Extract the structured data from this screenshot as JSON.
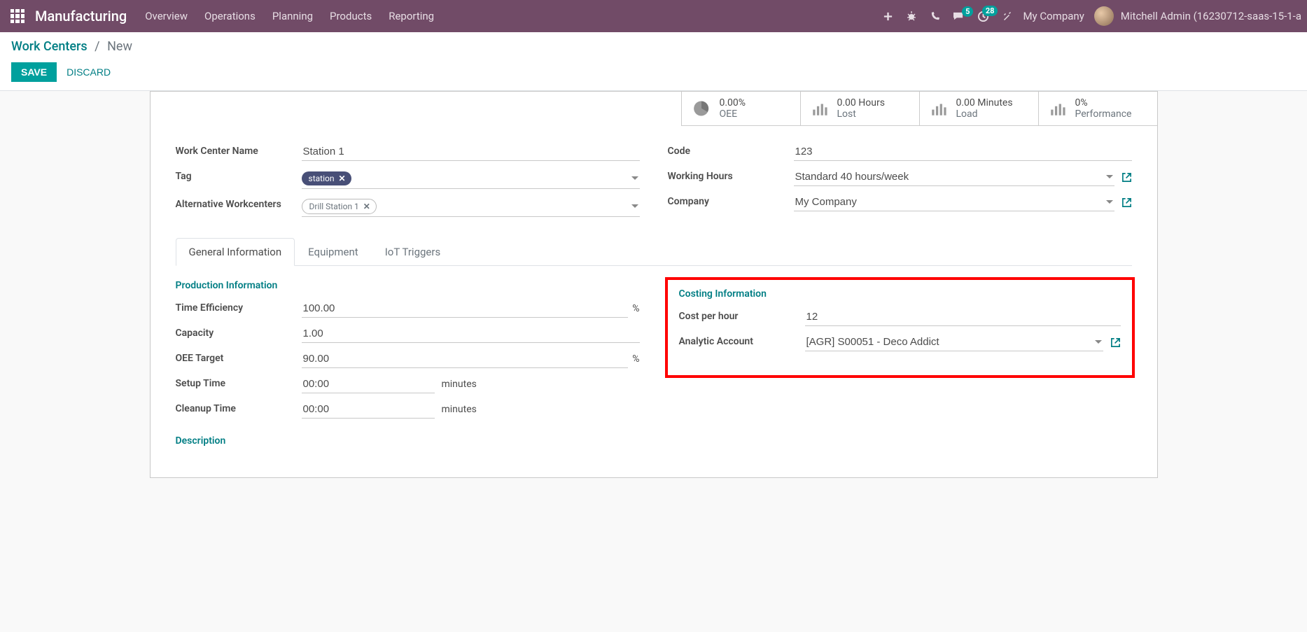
{
  "nav": {
    "brand": "Manufacturing",
    "menu": [
      "Overview",
      "Operations",
      "Planning",
      "Products",
      "Reporting"
    ],
    "msg_badge": "5",
    "activity_badge": "28",
    "company": "My Company",
    "user": "Mitchell Admin (16230712-saas-15-1-a"
  },
  "breadcrumb": {
    "root": "Work Centers",
    "leaf": "New"
  },
  "buttons": {
    "save": "Save",
    "discard": "Discard"
  },
  "stats": {
    "oee": {
      "value": "0.00%",
      "label": "OEE"
    },
    "lost": {
      "value": "0.00 Hours",
      "label": "Lost"
    },
    "load": {
      "value": "0.00 Minutes",
      "label": "Load"
    },
    "perf": {
      "value": "0%",
      "label": "Performance"
    }
  },
  "fields": {
    "name_label": "Work Center Name",
    "name_value": "Station 1",
    "tag_label": "Tag",
    "tag_value": "station",
    "alt_label": "Alternative Workcenters",
    "alt_value": "Drill Station 1",
    "code_label": "Code",
    "code_value": "123",
    "hours_label": "Working Hours",
    "hours_value": "Standard 40 hours/week",
    "company_label": "Company",
    "company_value": "My Company"
  },
  "tabs": {
    "general": "General Information",
    "equipment": "Equipment",
    "iot": "IoT Triggers"
  },
  "prod": {
    "section": "Production Information",
    "eff_label": "Time Efficiency",
    "eff_value": "100.00",
    "cap_label": "Capacity",
    "cap_value": "1.00",
    "oee_label": "OEE Target",
    "oee_value": "90.00",
    "setup_label": "Setup Time",
    "setup_value": "00:00",
    "cleanup_label": "Cleanup Time",
    "cleanup_value": "00:00",
    "percent": "%",
    "minutes": "minutes",
    "desc": "Description"
  },
  "cost": {
    "section": "Costing Information",
    "cph_label": "Cost per hour",
    "cph_value": "12",
    "acc_label": "Analytic Account",
    "acc_value": "[AGR] S00051 - Deco Addict"
  }
}
